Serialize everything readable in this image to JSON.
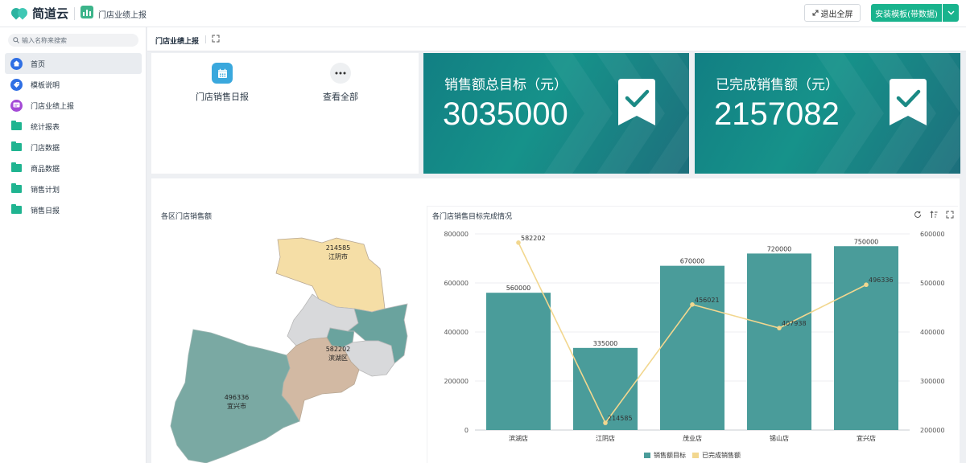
{
  "app": {
    "brand": "简道云",
    "app_name": "门店业绩上报",
    "exit_fullscreen_label": "退出全屏",
    "install_label": "安装模板(带数据)"
  },
  "sidebar": {
    "search_placeholder": "输入名称来搜索",
    "items": [
      {
        "label": "首页",
        "icon": "home-icon",
        "color": "#2f6fe4"
      },
      {
        "label": "模板说明",
        "icon": "tag-icon",
        "color": "#2f6fe4"
      },
      {
        "label": "门店业绩上报",
        "icon": "form-icon",
        "color": "#a44ad6"
      },
      {
        "label": "统计报表",
        "icon": "folder-icon",
        "color": "#1fb490"
      },
      {
        "label": "门店数据",
        "icon": "folder-icon",
        "color": "#1fb490"
      },
      {
        "label": "商品数据",
        "icon": "folder-icon",
        "color": "#1fb490"
      },
      {
        "label": "销售计划",
        "icon": "folder-icon",
        "color": "#1fb490"
      },
      {
        "label": "销售日报",
        "icon": "folder-icon",
        "color": "#1fb490"
      }
    ]
  },
  "page": {
    "title": "门店业绩上报"
  },
  "shortcuts": [
    {
      "label": "门店销售日报",
      "icon": "calendar-icon",
      "color": "#3aa8dd"
    },
    {
      "label": "查看全部",
      "icon": "more-icon",
      "color": "#eef0f2"
    }
  ],
  "stats": [
    {
      "label": "销售额总目标（元）",
      "value": "3035000"
    },
    {
      "label": "已完成销售额（元）",
      "value": "2157082"
    }
  ],
  "map": {
    "title": "各区门店销售额",
    "regions": [
      {
        "value": "214585",
        "name": "江阴市",
        "color": "#f5dea6"
      },
      {
        "value": "582202",
        "name": "滨湖区",
        "color": "#d2b9a3"
      },
      {
        "value": "496336",
        "name": "宜兴市",
        "color": "#7aa9a3"
      }
    ],
    "other_colors": [
      "#d8d9db",
      "#6aa39e"
    ]
  },
  "chart_data": {
    "type": "bar",
    "title": "各门店销售目标完成情况",
    "categories": [
      "滨湖店",
      "江阴店",
      "茂业店",
      "锡山店",
      "宜兴店"
    ],
    "series": [
      {
        "name": "销售额目标",
        "type": "bar",
        "axis": "left",
        "color": "#4a9c9a",
        "values": [
          560000,
          335000,
          670000,
          720000,
          750000
        ]
      },
      {
        "name": "已完成销售额",
        "type": "line",
        "axis": "right",
        "color": "#f2d78f",
        "values": [
          582202,
          214585,
          456021,
          407938,
          496336
        ]
      }
    ],
    "y_left": {
      "ylim": [
        0,
        800000
      ],
      "ticks": [
        "0",
        "200000",
        "400000",
        "600000",
        "800000"
      ]
    },
    "y_right": {
      "ylim": [
        200000,
        600000
      ],
      "ticks": [
        "200000",
        "300000",
        "400000",
        "500000",
        "600000"
      ]
    },
    "legend_position": "bottom-center",
    "grid": true
  }
}
